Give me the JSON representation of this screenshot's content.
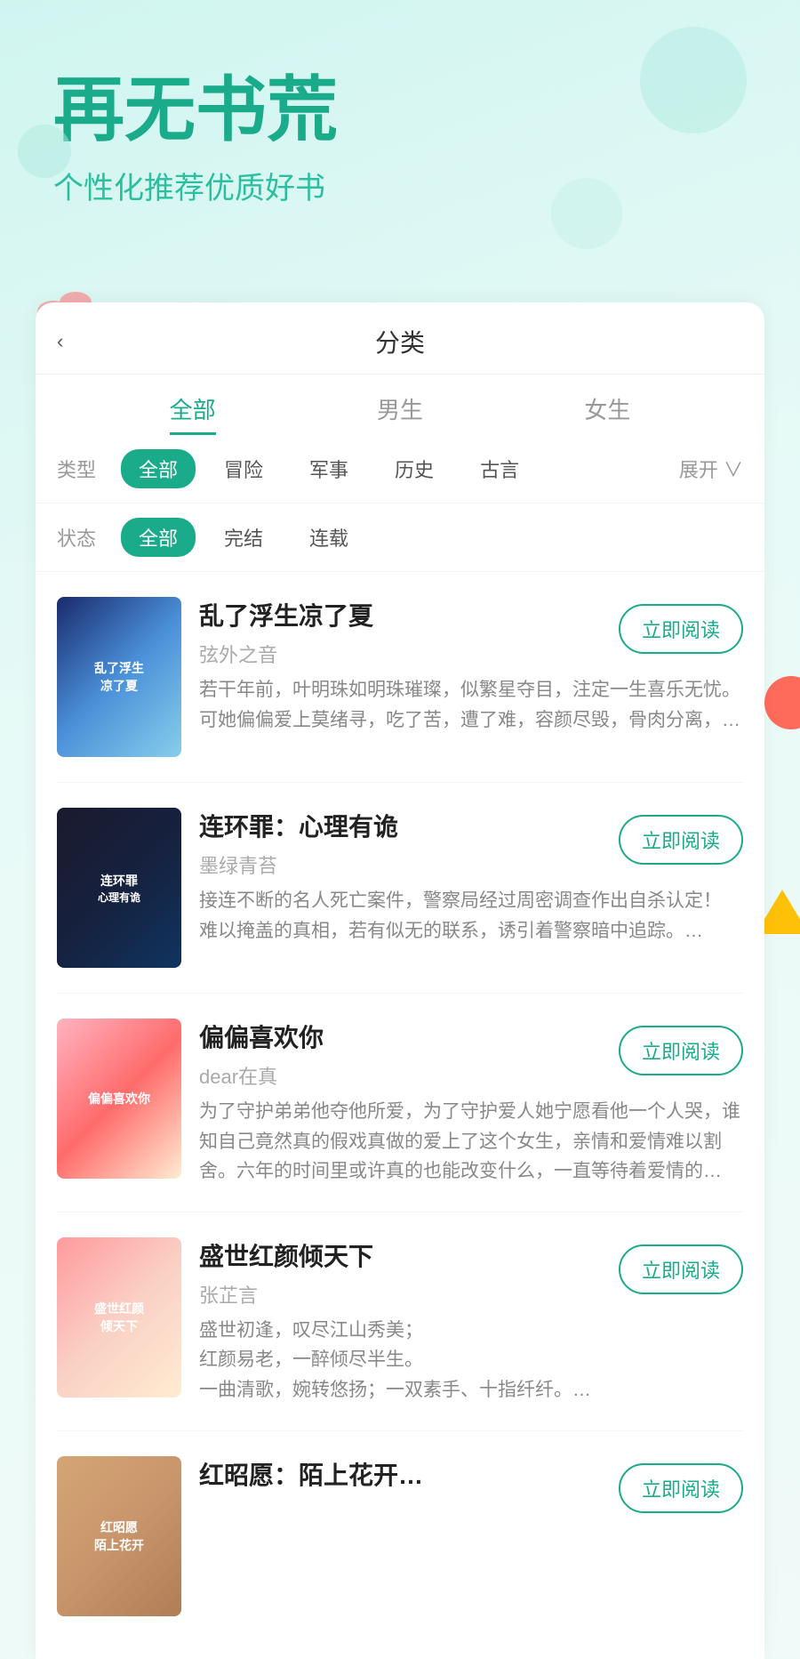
{
  "hero": {
    "title": "再无书荒",
    "subtitle": "个性化推荐优质好书"
  },
  "page": {
    "back_label": "‹",
    "title": "分类"
  },
  "gender_tabs": [
    {
      "id": "all",
      "label": "全部",
      "active": true
    },
    {
      "id": "male",
      "label": "男生",
      "active": false
    },
    {
      "id": "female",
      "label": "女生",
      "active": false
    }
  ],
  "filter_type": {
    "label": "类型",
    "chips": [
      {
        "id": "all",
        "label": "全部",
        "active": true
      },
      {
        "id": "adventure",
        "label": "冒险",
        "active": false
      },
      {
        "id": "military",
        "label": "军事",
        "active": false
      },
      {
        "id": "history",
        "label": "历史",
        "active": false
      },
      {
        "id": "ancient",
        "label": "古言",
        "active": false
      }
    ],
    "expand_label": "展开 ∨"
  },
  "filter_status": {
    "label": "状态",
    "chips": [
      {
        "id": "all",
        "label": "全部",
        "active": true
      },
      {
        "id": "finished",
        "label": "完结",
        "active": false
      },
      {
        "id": "ongoing",
        "label": "连载",
        "active": false
      }
    ]
  },
  "books": [
    {
      "id": 1,
      "title": "乱了浮生凉了夏",
      "author": "弦外之音",
      "desc": "若干年前，叶明珠如明珠璀璨，似繁星夺目，注定一生喜乐无忧。\n可她偏偏爱上莫绪寻，吃了苦，遭了难，容颜尽毁，骨肉分离，…",
      "read_btn": "立即阅读",
      "cover_class": "cover-1",
      "cover_text": "乱了浮生\n凉了夏"
    },
    {
      "id": 2,
      "title": "连环罪：心理有诡",
      "author": "墨绿青苔",
      "desc": "接连不断的名人死亡案件，警察局经过周密调查作出自杀认定！\n难以掩盖的真相，若有似无的联系，诱引着警察暗中追踪。…",
      "read_btn": "立即阅读",
      "cover_class": "cover-2",
      "cover_text": "连环罪\n心理有诡"
    },
    {
      "id": 3,
      "title": "偏偏喜欢你",
      "author": "dear在真",
      "desc": "为了守护弟弟他夺他所爱，为了守护爱人她宁愿看他一个人哭，谁知自己竟然真的假戏真做的爱上了这个女生，亲情和爱情难以割舍。六年的时间里或许真的也能改变什么，一直等待着爱情的…",
      "read_btn": "立即阅读",
      "cover_class": "cover-3",
      "cover_text": "偏偏喜欢你"
    },
    {
      "id": 4,
      "title": "盛世红颜倾天下",
      "author": "张芷言",
      "desc": "盛世初逢，叹尽江山秀美；\n红颜易老，一醉倾尽半生。\n一曲清歌，婉转悠扬；一双素手、十指纤纤。…",
      "read_btn": "立即阅读",
      "cover_class": "cover-4",
      "cover_text": "盛世红颜\n倾天下"
    },
    {
      "id": 5,
      "title": "红昭愿：陌上花开…",
      "author": "",
      "desc": "",
      "read_btn": "立即阅读",
      "cover_class": "cover-5",
      "cover_text": "红昭愿\n陌上花开"
    }
  ]
}
